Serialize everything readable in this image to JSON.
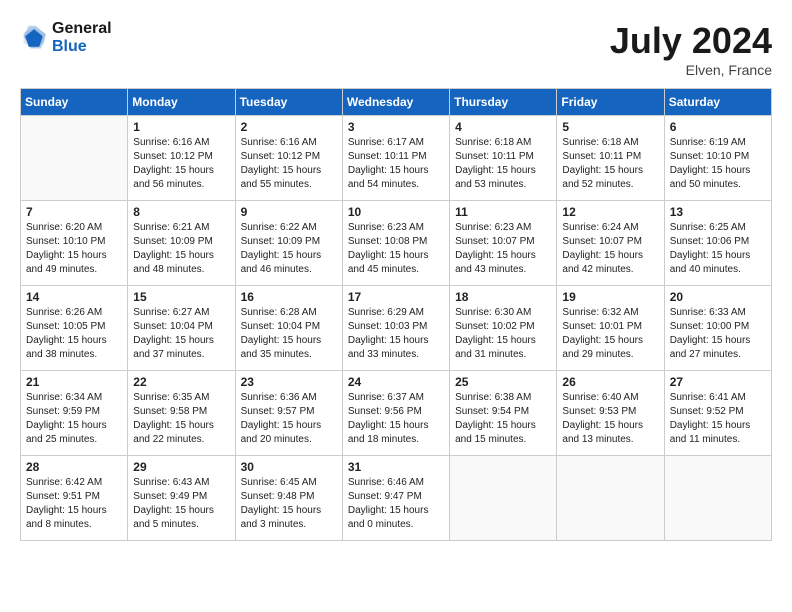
{
  "header": {
    "logo_line1": "General",
    "logo_line2": "Blue",
    "month": "July 2024",
    "location": "Elven, France"
  },
  "days_of_week": [
    "Sunday",
    "Monday",
    "Tuesday",
    "Wednesday",
    "Thursday",
    "Friday",
    "Saturday"
  ],
  "weeks": [
    [
      {
        "day": "",
        "content": ""
      },
      {
        "day": "1",
        "content": "Sunrise: 6:16 AM\nSunset: 10:12 PM\nDaylight: 15 hours\nand 56 minutes."
      },
      {
        "day": "2",
        "content": "Sunrise: 6:16 AM\nSunset: 10:12 PM\nDaylight: 15 hours\nand 55 minutes."
      },
      {
        "day": "3",
        "content": "Sunrise: 6:17 AM\nSunset: 10:11 PM\nDaylight: 15 hours\nand 54 minutes."
      },
      {
        "day": "4",
        "content": "Sunrise: 6:18 AM\nSunset: 10:11 PM\nDaylight: 15 hours\nand 53 minutes."
      },
      {
        "day": "5",
        "content": "Sunrise: 6:18 AM\nSunset: 10:11 PM\nDaylight: 15 hours\nand 52 minutes."
      },
      {
        "day": "6",
        "content": "Sunrise: 6:19 AM\nSunset: 10:10 PM\nDaylight: 15 hours\nand 50 minutes."
      }
    ],
    [
      {
        "day": "7",
        "content": "Sunrise: 6:20 AM\nSunset: 10:10 PM\nDaylight: 15 hours\nand 49 minutes."
      },
      {
        "day": "8",
        "content": "Sunrise: 6:21 AM\nSunset: 10:09 PM\nDaylight: 15 hours\nand 48 minutes."
      },
      {
        "day": "9",
        "content": "Sunrise: 6:22 AM\nSunset: 10:09 PM\nDaylight: 15 hours\nand 46 minutes."
      },
      {
        "day": "10",
        "content": "Sunrise: 6:23 AM\nSunset: 10:08 PM\nDaylight: 15 hours\nand 45 minutes."
      },
      {
        "day": "11",
        "content": "Sunrise: 6:23 AM\nSunset: 10:07 PM\nDaylight: 15 hours\nand 43 minutes."
      },
      {
        "day": "12",
        "content": "Sunrise: 6:24 AM\nSunset: 10:07 PM\nDaylight: 15 hours\nand 42 minutes."
      },
      {
        "day": "13",
        "content": "Sunrise: 6:25 AM\nSunset: 10:06 PM\nDaylight: 15 hours\nand 40 minutes."
      }
    ],
    [
      {
        "day": "14",
        "content": "Sunrise: 6:26 AM\nSunset: 10:05 PM\nDaylight: 15 hours\nand 38 minutes."
      },
      {
        "day": "15",
        "content": "Sunrise: 6:27 AM\nSunset: 10:04 PM\nDaylight: 15 hours\nand 37 minutes."
      },
      {
        "day": "16",
        "content": "Sunrise: 6:28 AM\nSunset: 10:04 PM\nDaylight: 15 hours\nand 35 minutes."
      },
      {
        "day": "17",
        "content": "Sunrise: 6:29 AM\nSunset: 10:03 PM\nDaylight: 15 hours\nand 33 minutes."
      },
      {
        "day": "18",
        "content": "Sunrise: 6:30 AM\nSunset: 10:02 PM\nDaylight: 15 hours\nand 31 minutes."
      },
      {
        "day": "19",
        "content": "Sunrise: 6:32 AM\nSunset: 10:01 PM\nDaylight: 15 hours\nand 29 minutes."
      },
      {
        "day": "20",
        "content": "Sunrise: 6:33 AM\nSunset: 10:00 PM\nDaylight: 15 hours\nand 27 minutes."
      }
    ],
    [
      {
        "day": "21",
        "content": "Sunrise: 6:34 AM\nSunset: 9:59 PM\nDaylight: 15 hours\nand 25 minutes."
      },
      {
        "day": "22",
        "content": "Sunrise: 6:35 AM\nSunset: 9:58 PM\nDaylight: 15 hours\nand 22 minutes."
      },
      {
        "day": "23",
        "content": "Sunrise: 6:36 AM\nSunset: 9:57 PM\nDaylight: 15 hours\nand 20 minutes."
      },
      {
        "day": "24",
        "content": "Sunrise: 6:37 AM\nSunset: 9:56 PM\nDaylight: 15 hours\nand 18 minutes."
      },
      {
        "day": "25",
        "content": "Sunrise: 6:38 AM\nSunset: 9:54 PM\nDaylight: 15 hours\nand 15 minutes."
      },
      {
        "day": "26",
        "content": "Sunrise: 6:40 AM\nSunset: 9:53 PM\nDaylight: 15 hours\nand 13 minutes."
      },
      {
        "day": "27",
        "content": "Sunrise: 6:41 AM\nSunset: 9:52 PM\nDaylight: 15 hours\nand 11 minutes."
      }
    ],
    [
      {
        "day": "28",
        "content": "Sunrise: 6:42 AM\nSunset: 9:51 PM\nDaylight: 15 hours\nand 8 minutes."
      },
      {
        "day": "29",
        "content": "Sunrise: 6:43 AM\nSunset: 9:49 PM\nDaylight: 15 hours\nand 5 minutes."
      },
      {
        "day": "30",
        "content": "Sunrise: 6:45 AM\nSunset: 9:48 PM\nDaylight: 15 hours\nand 3 minutes."
      },
      {
        "day": "31",
        "content": "Sunrise: 6:46 AM\nSunset: 9:47 PM\nDaylight: 15 hours\nand 0 minutes."
      },
      {
        "day": "",
        "content": ""
      },
      {
        "day": "",
        "content": ""
      },
      {
        "day": "",
        "content": ""
      }
    ]
  ]
}
